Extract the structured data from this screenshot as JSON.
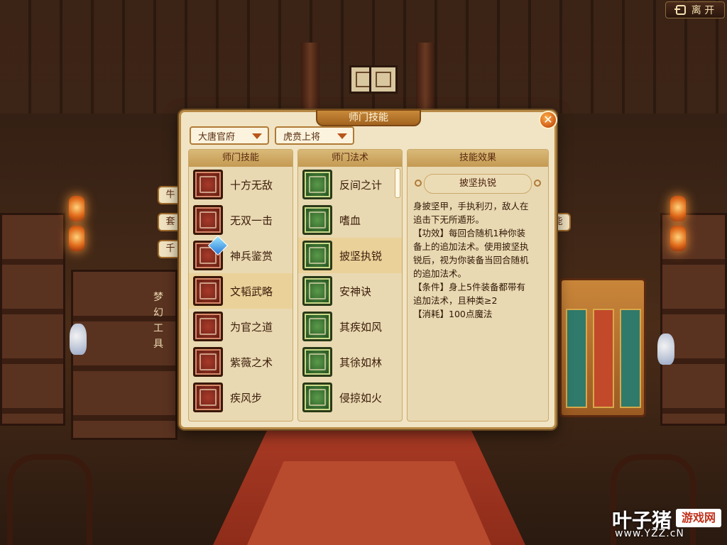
{
  "top_bar": {
    "exit_label": "离 开"
  },
  "side_tabs": [
    "牛",
    "套",
    "千",
    "能"
  ],
  "side_vertical_label": "梦幻工具",
  "dialog": {
    "title": "师门技能",
    "school_dropdown": "大唐官府",
    "rank_dropdown": "虎贲上将",
    "skills_column": {
      "title": "师门技能",
      "selected_index": 3,
      "items": [
        {
          "label": "十方无敌",
          "icon": "crossed-swords-icon"
        },
        {
          "label": "无双一击",
          "icon": "beast-face-icon"
        },
        {
          "label": "神兵鉴赏",
          "icon": "weapon-appraisal-icon"
        },
        {
          "label": "文韬武略",
          "icon": "gate-icon"
        },
        {
          "label": "为官之道",
          "icon": "official-icon"
        },
        {
          "label": "紫薇之术",
          "icon": "rune-icon"
        },
        {
          "label": "疾风步",
          "icon": "wind-step-icon"
        }
      ]
    },
    "spells_column": {
      "title": "师门法术",
      "selected_index": 2,
      "items": [
        {
          "label": "反间之计",
          "icon": "two-heads-icon"
        },
        {
          "label": "嗜血",
          "icon": "fangs-icon"
        },
        {
          "label": "披坚执锐",
          "icon": "armor-fist-icon"
        },
        {
          "label": "安神诀",
          "icon": "meditation-icon"
        },
        {
          "label": "其疾如风",
          "icon": "wind-sigil-icon"
        },
        {
          "label": "其徐如林",
          "icon": "forest-sigil-icon"
        },
        {
          "label": "侵掠如火",
          "icon": "fire-sigil-icon"
        }
      ]
    },
    "effect_column": {
      "title": "技能效果",
      "skill_name": "披坚执锐",
      "description": "身披坚甲，手执利刃，敌人在\n追击下无所遁形。\n【功效】每回合随机1种你装\n备上的追加法术。使用披坚执\n锐后，视为你装备当回合随机\n的追加法术。\n【条件】身上5件装备都带有\n追加法术，且种类≥2\n【消耗】100点魔法"
    }
  },
  "watermark": {
    "brand": "叶子猪",
    "box": "游戏网",
    "url": "www.YZZ.cN"
  },
  "colors": {
    "panel_bg": "#f1e4c4",
    "selected_row": "#ead199",
    "accent_gold": "#b88a46"
  }
}
